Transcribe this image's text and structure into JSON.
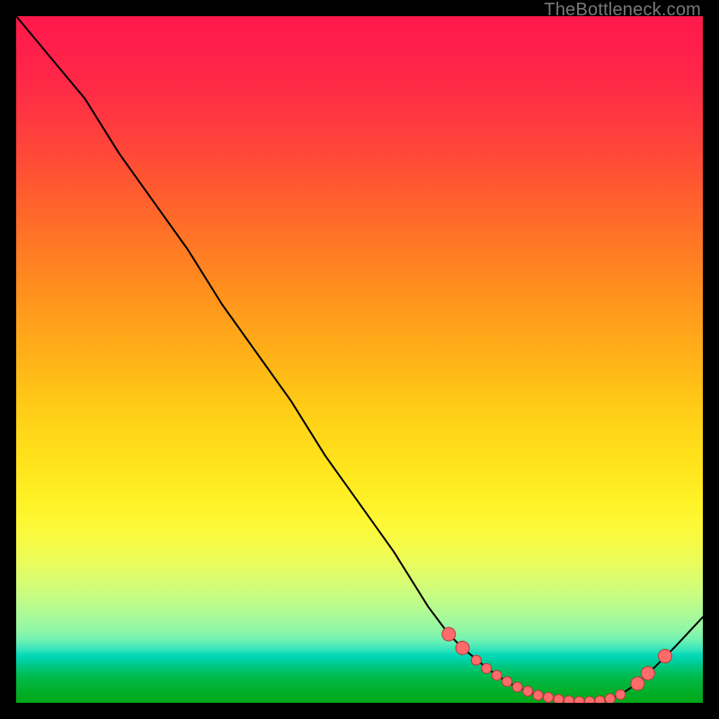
{
  "watermark": {
    "text": "TheBottleneck.com"
  },
  "gradient_stops": [
    {
      "offset": 0.0,
      "color": "#ff1a4b"
    },
    {
      "offset": 0.05,
      "color": "#ff1f4b"
    },
    {
      "offset": 0.1,
      "color": "#ff2a46"
    },
    {
      "offset": 0.15,
      "color": "#ff3840"
    },
    {
      "offset": 0.2,
      "color": "#ff4838"
    },
    {
      "offset": 0.25,
      "color": "#ff5a30"
    },
    {
      "offset": 0.3,
      "color": "#ff6c29"
    },
    {
      "offset": 0.35,
      "color": "#ff7e23"
    },
    {
      "offset": 0.4,
      "color": "#ff901e"
    },
    {
      "offset": 0.45,
      "color": "#ffa21a"
    },
    {
      "offset": 0.5,
      "color": "#ffb317"
    },
    {
      "offset": 0.55,
      "color": "#ffc516"
    },
    {
      "offset": 0.6,
      "color": "#ffd518"
    },
    {
      "offset": 0.65,
      "color": "#ffe31c"
    },
    {
      "offset": 0.7,
      "color": "#fff025"
    },
    {
      "offset": 0.72,
      "color": "#fff42c"
    },
    {
      "offset": 0.74,
      "color": "#fdf836"
    },
    {
      "offset": 0.76,
      "color": "#f8fa42"
    },
    {
      "offset": 0.78,
      "color": "#f1fb50"
    },
    {
      "offset": 0.8,
      "color": "#e7fc5f"
    },
    {
      "offset": 0.82,
      "color": "#dafc6f"
    },
    {
      "offset": 0.84,
      "color": "#cafc7f"
    },
    {
      "offset": 0.86,
      "color": "#b8fb8f"
    },
    {
      "offset": 0.88,
      "color": "#a2f99d"
    },
    {
      "offset": 0.895,
      "color": "#8ef6a7"
    },
    {
      "offset": 0.905,
      "color": "#78f3af"
    },
    {
      "offset": 0.912,
      "color": "#62efb5"
    },
    {
      "offset": 0.917,
      "color": "#4ceab9"
    },
    {
      "offset": 0.922,
      "color": "#36e5ba"
    },
    {
      "offset": 0.926,
      "color": "#20e0bb"
    },
    {
      "offset": 0.929,
      "color": "#0bdaba"
    },
    {
      "offset": 0.935,
      "color": "#00d5b0"
    },
    {
      "offset": 0.94,
      "color": "#00cf9e"
    },
    {
      "offset": 0.945,
      "color": "#00c987"
    },
    {
      "offset": 0.952,
      "color": "#00c36d"
    },
    {
      "offset": 0.96,
      "color": "#00bc54"
    },
    {
      "offset": 0.97,
      "color": "#00b63d"
    },
    {
      "offset": 0.985,
      "color": "#00af28"
    },
    {
      "offset": 1.0,
      "color": "#00a818"
    }
  ],
  "chart_data": {
    "type": "line",
    "title": "",
    "xlabel": "",
    "ylabel": "",
    "xlim": [
      0,
      100
    ],
    "ylim": [
      0,
      100
    ],
    "series": [
      {
        "name": "curve",
        "x": [
          0,
          5,
          10,
          15,
          20,
          25,
          30,
          35,
          40,
          45,
          50,
          55,
          60,
          63,
          65,
          68,
          70,
          72,
          74,
          76,
          78,
          80,
          82,
          84,
          86,
          88,
          90,
          93,
          96,
          100
        ],
        "y": [
          100,
          94,
          88,
          80,
          73,
          66,
          58,
          51,
          44,
          36,
          29,
          22,
          14,
          10,
          8,
          5.5,
          4,
          2.8,
          1.8,
          1.1,
          0.6,
          0.3,
          0.2,
          0.2,
          0.4,
          1.2,
          2.5,
          5.2,
          8.2,
          12.5
        ]
      }
    ],
    "markers": {
      "name": "highlight",
      "color": "#ff6b6b",
      "stroke": "#b53c3c",
      "radius_small": 5.5,
      "radius_large": 7.5,
      "points": [
        {
          "x": 63.0,
          "y": 10.0,
          "size": "large"
        },
        {
          "x": 65.0,
          "y": 8.0,
          "size": "large"
        },
        {
          "x": 67.0,
          "y": 6.2,
          "size": "small"
        },
        {
          "x": 68.5,
          "y": 5.0,
          "size": "small"
        },
        {
          "x": 70.0,
          "y": 4.0,
          "size": "small"
        },
        {
          "x": 71.5,
          "y": 3.1,
          "size": "small"
        },
        {
          "x": 73.0,
          "y": 2.3,
          "size": "small"
        },
        {
          "x": 74.5,
          "y": 1.7,
          "size": "small"
        },
        {
          "x": 76.0,
          "y": 1.1,
          "size": "small"
        },
        {
          "x": 77.5,
          "y": 0.8,
          "size": "small"
        },
        {
          "x": 79.0,
          "y": 0.5,
          "size": "small"
        },
        {
          "x": 80.5,
          "y": 0.3,
          "size": "small"
        },
        {
          "x": 82.0,
          "y": 0.2,
          "size": "small"
        },
        {
          "x": 83.5,
          "y": 0.2,
          "size": "small"
        },
        {
          "x": 85.0,
          "y": 0.3,
          "size": "small"
        },
        {
          "x": 86.5,
          "y": 0.6,
          "size": "small"
        },
        {
          "x": 88.0,
          "y": 1.2,
          "size": "small"
        },
        {
          "x": 90.5,
          "y": 2.8,
          "size": "large"
        },
        {
          "x": 92.0,
          "y": 4.3,
          "size": "large"
        },
        {
          "x": 94.5,
          "y": 6.8,
          "size": "large"
        }
      ]
    }
  }
}
